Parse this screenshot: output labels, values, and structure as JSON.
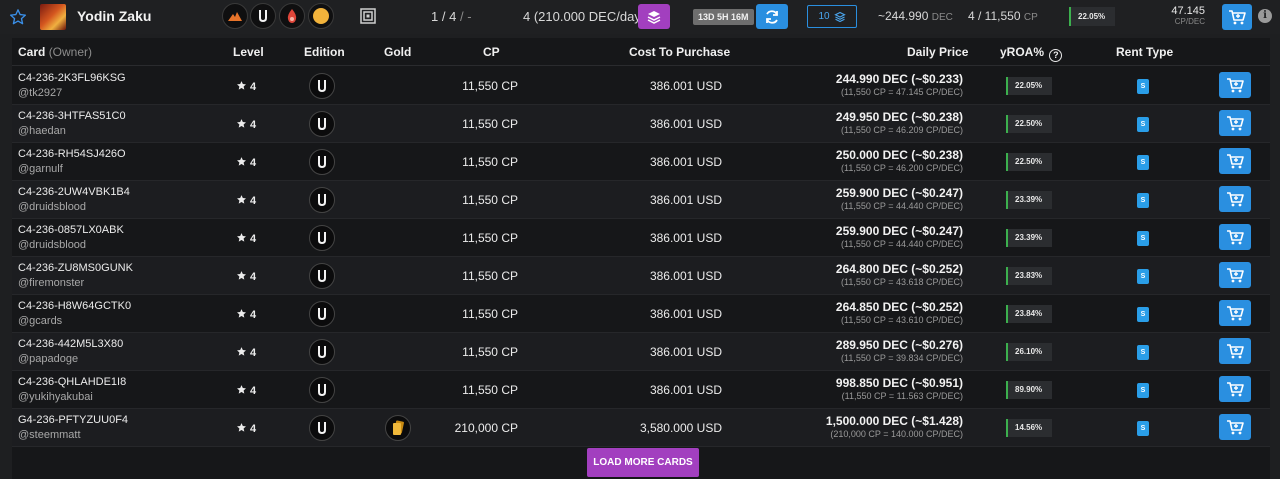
{
  "header": {
    "card_name": "Yodin Zaku",
    "page_current": "1",
    "page_sep": "/",
    "page_total": "4",
    "page_suffix": "/ -",
    "listing_summary": "4 (210.000 DEC/day)",
    "timer": "13D 5H 16M",
    "quantity": "10",
    "price_value": "~244.990",
    "price_unit": "DEC",
    "cp_value": "4 / 11,550",
    "cp_unit": "CP",
    "yroa": "22.05%",
    "cp_per_dec_value": "47.145",
    "cp_per_dec_unit": "CP/DEC",
    "accent_color": "#a23fbf",
    "action_color": "#2a8fe0"
  },
  "table": {
    "headers": {
      "card": "Card",
      "owner": "(Owner)",
      "level": "Level",
      "edition": "Edition",
      "gold": "Gold",
      "cp": "CP",
      "cost": "Cost To Purchase",
      "daily_price": "Daily Price",
      "yroa": "yROA%",
      "rent_type": "Rent Type"
    },
    "rows": [
      {
        "id": "C4-236-2K3FL96KSG",
        "owner": "@tk2927",
        "level": "4",
        "gold": false,
        "cp": "11,550 CP",
        "cost": "386.001 USD",
        "price": "244.990 DEC (~$0.233)",
        "ratio": "(11,550 CP = 47.145 CP/DEC)",
        "yroa": "22.05%",
        "rent": "S"
      },
      {
        "id": "C4-236-3HTFAS51C0",
        "owner": "@haedan",
        "level": "4",
        "gold": false,
        "cp": "11,550 CP",
        "cost": "386.001 USD",
        "price": "249.950 DEC (~$0.238)",
        "ratio": "(11,550 CP = 46.209 CP/DEC)",
        "yroa": "22.50%",
        "rent": "S"
      },
      {
        "id": "C4-236-RH54SJ426O",
        "owner": "@garnulf",
        "level": "4",
        "gold": false,
        "cp": "11,550 CP",
        "cost": "386.001 USD",
        "price": "250.000 DEC (~$0.238)",
        "ratio": "(11,550 CP = 46.200 CP/DEC)",
        "yroa": "22.50%",
        "rent": "S"
      },
      {
        "id": "C4-236-2UW4VBK1B4",
        "owner": "@druidsblood",
        "level": "4",
        "gold": false,
        "cp": "11,550 CP",
        "cost": "386.001 USD",
        "price": "259.900 DEC (~$0.247)",
        "ratio": "(11,550 CP = 44.440 CP/DEC)",
        "yroa": "23.39%",
        "rent": "S"
      },
      {
        "id": "C4-236-0857LX0ABK",
        "owner": "@druidsblood",
        "level": "4",
        "gold": false,
        "cp": "11,550 CP",
        "cost": "386.001 USD",
        "price": "259.900 DEC (~$0.247)",
        "ratio": "(11,550 CP = 44.440 CP/DEC)",
        "yroa": "23.39%",
        "rent": "S"
      },
      {
        "id": "C4-236-ZU8MS0GUNK",
        "owner": "@firemonster",
        "level": "4",
        "gold": false,
        "cp": "11,550 CP",
        "cost": "386.001 USD",
        "price": "264.800 DEC (~$0.252)",
        "ratio": "(11,550 CP = 43.618 CP/DEC)",
        "yroa": "23.83%",
        "rent": "S"
      },
      {
        "id": "C4-236-H8W64GCTK0",
        "owner": "@gcards",
        "level": "4",
        "gold": false,
        "cp": "11,550 CP",
        "cost": "386.001 USD",
        "price": "264.850 DEC (~$0.252)",
        "ratio": "(11,550 CP = 43.610 CP/DEC)",
        "yroa": "23.84%",
        "rent": "S"
      },
      {
        "id": "C4-236-442M5L3X80",
        "owner": "@papadoge",
        "level": "4",
        "gold": false,
        "cp": "11,550 CP",
        "cost": "386.001 USD",
        "price": "289.950 DEC (~$0.276)",
        "ratio": "(11,550 CP = 39.834 CP/DEC)",
        "yroa": "26.10%",
        "rent": "S"
      },
      {
        "id": "C4-236-QHLAHDE1I8",
        "owner": "@yukihyakubai",
        "level": "4",
        "gold": false,
        "cp": "11,550 CP",
        "cost": "386.001 USD",
        "price": "998.850 DEC (~$0.951)",
        "ratio": "(11,550 CP = 11.563 CP/DEC)",
        "yroa": "89.90%",
        "rent": "S"
      },
      {
        "id": "G4-236-PFTYZUU0F4",
        "owner": "@steemmatt",
        "level": "4",
        "gold": true,
        "cp": "210,000 CP",
        "cost": "3,580.000 USD",
        "price": "1,500.000 DEC (~$1.428)",
        "ratio": "(210,000 CP = 140.000 CP/DEC)",
        "yroa": "14.56%",
        "rent": "S"
      }
    ]
  },
  "load_more_label": "LOAD MORE CARDS",
  "icons": {
    "favorite": "star-outline-icon",
    "element": "fire-element-icon",
    "edition": "untamed-edition-icon",
    "rarity": "rarity-drop-icon",
    "gold": "gold-coin-icon",
    "frame": "card-frame-icon",
    "stack": "layers-icon",
    "refresh": "refresh-icon",
    "cart": "cart-icon",
    "info": "info-icon",
    "level": "star-icon"
  }
}
